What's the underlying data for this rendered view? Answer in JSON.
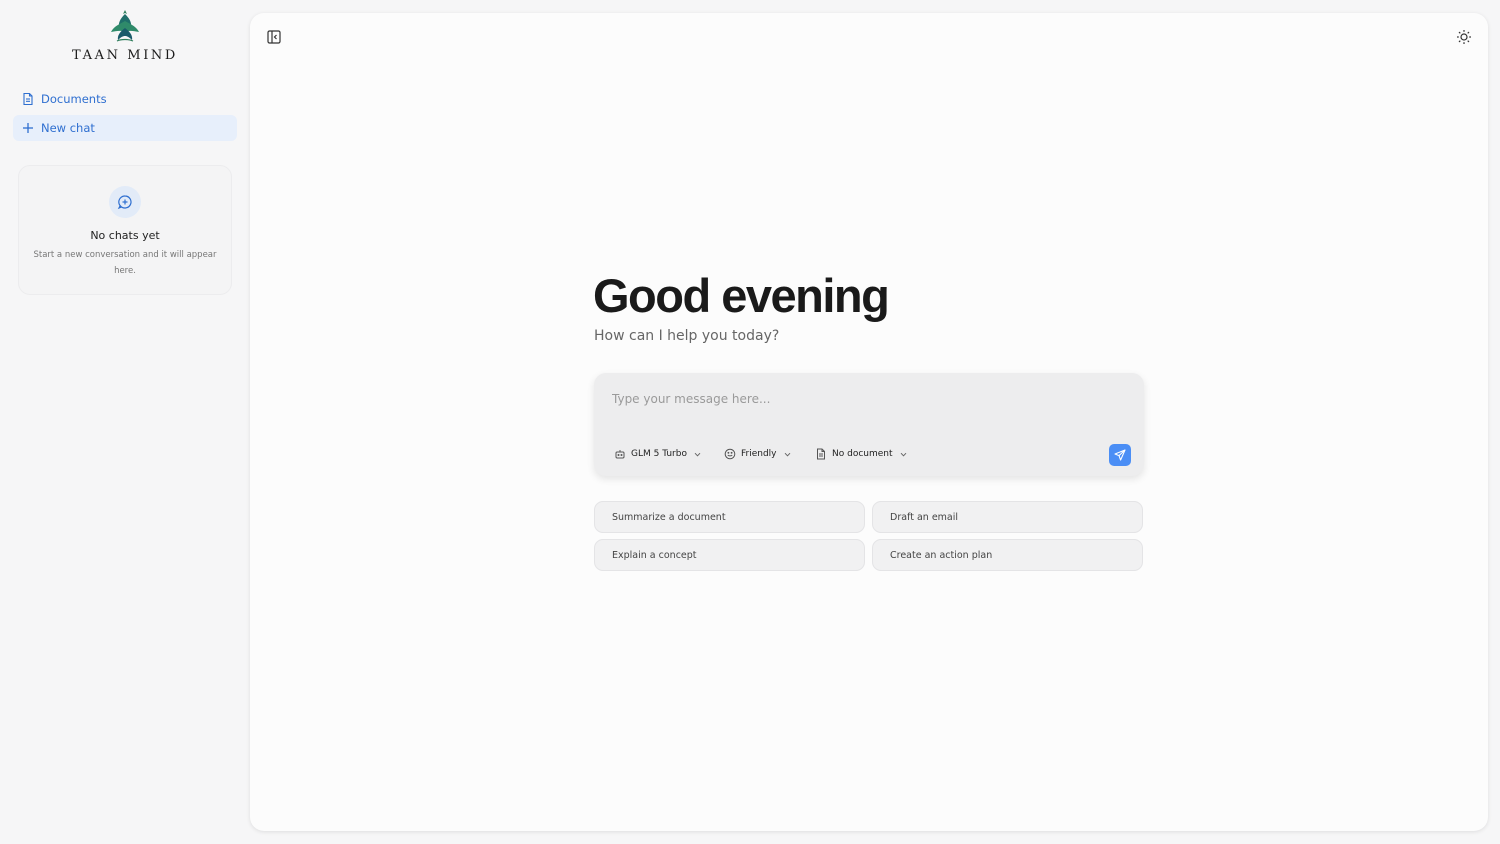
{
  "brand": {
    "name": "TAAN MIND",
    "logo_icon": "lotus-logo-icon"
  },
  "sidebar": {
    "items": [
      {
        "label": "Documents",
        "icon": "document-icon"
      },
      {
        "label": "New chat",
        "icon": "plus-icon"
      }
    ],
    "empty_state": {
      "icon": "chat-plus-icon",
      "title": "No chats yet",
      "subtitle": "Start a new conversation and it will appear here."
    }
  },
  "main": {
    "greeting": "Good evening",
    "subgreeting": "How can I help you today?",
    "composer": {
      "placeholder": "Type your message here...",
      "model": "GLM 5 Turbo",
      "tone": "Friendly",
      "document": "No document"
    },
    "suggestions": [
      "Summarize a document",
      "Draft an email",
      "Explain a concept",
      "Create an action plan"
    ]
  },
  "colors": {
    "accent": "#2f6fd0",
    "send_button": "#4b8ef5",
    "nav_active_bg": "#e7effb"
  }
}
